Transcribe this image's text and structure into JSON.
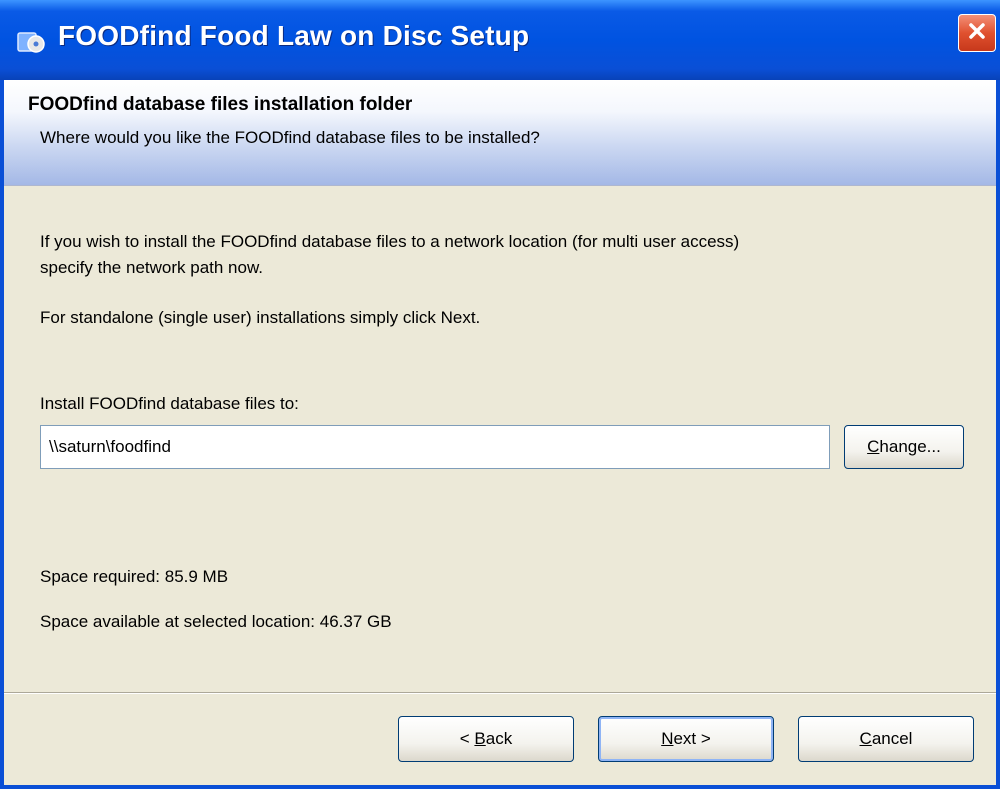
{
  "window": {
    "title": "FOODfind Food Law on Disc Setup"
  },
  "header": {
    "title": "FOODfind database files installation folder",
    "subtitle": "Where would you like the FOODfind database files to be installed?"
  },
  "body": {
    "intro_line1": "If you wish to install the FOODfind database files to a network location (for multi user access)",
    "intro_line2": "specify the network path now.",
    "standalone_note": "For standalone (single user) installations simply click Next.",
    "install_label": "Install FOODfind database files to:",
    "path_value": "\\\\saturn\\foodfind",
    "space_required": "Space required: 85.9 MB",
    "space_available": "Space available at selected location: 46.37 GB"
  },
  "buttons": {
    "change_accel": "C",
    "change_rest": "hange...",
    "back_prefix": "< ",
    "back_accel": "B",
    "back_rest": "ack",
    "next_accel": "N",
    "next_rest": "ext >",
    "cancel_accel": "C",
    "cancel_rest": "ancel"
  },
  "colors": {
    "titlebar": "#0053e1",
    "close_button": "#e0512f",
    "dialog_face": "#ece9d8"
  },
  "icons": {
    "title": "setup-disc-icon",
    "close": "close-x-icon"
  }
}
